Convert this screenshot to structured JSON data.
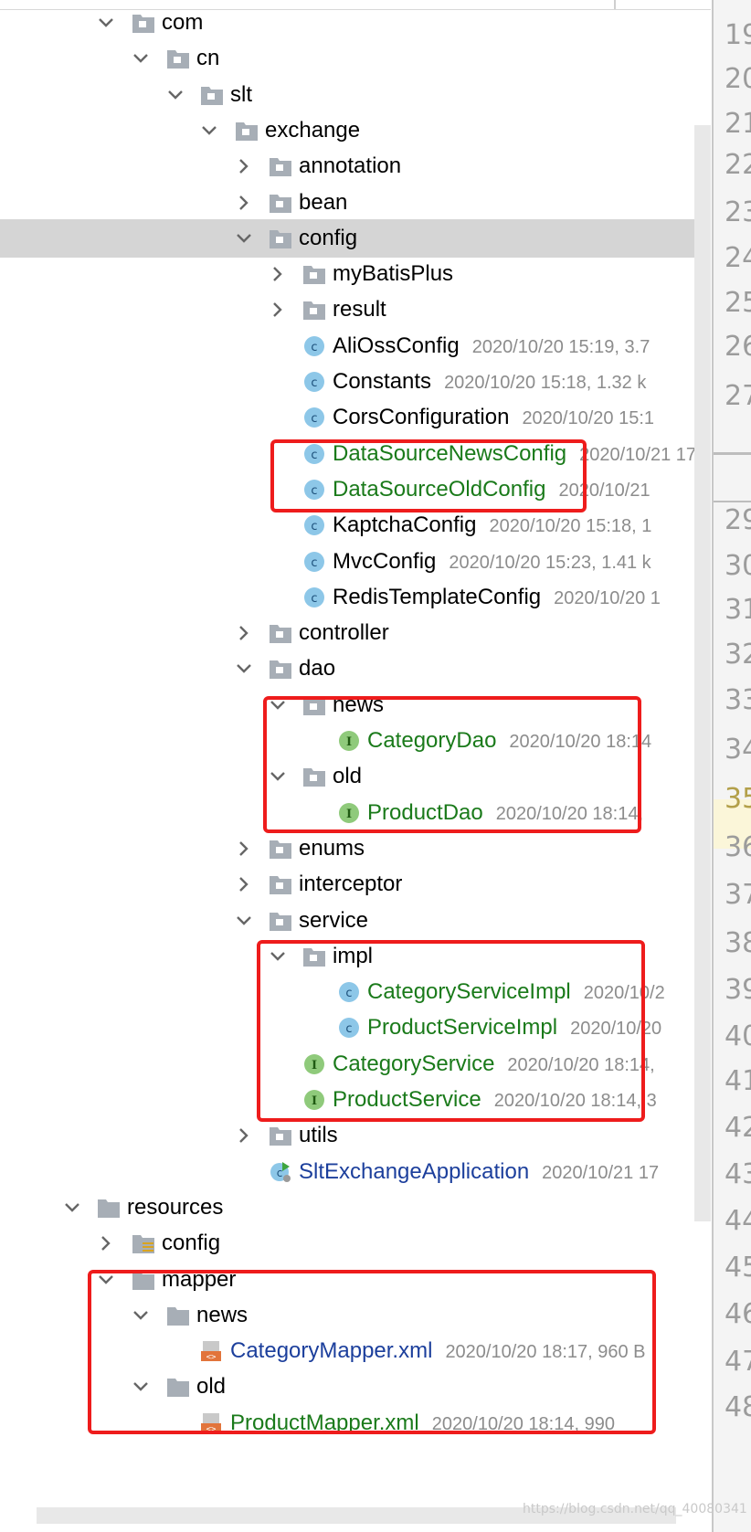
{
  "tree": {
    "rows": [
      {
        "label": "com",
        "kind": "package",
        "expanded": true,
        "meta": "",
        "color": "black"
      },
      {
        "label": "cn",
        "kind": "package",
        "expanded": true,
        "meta": "",
        "color": "black"
      },
      {
        "label": "slt",
        "kind": "package",
        "expanded": true,
        "meta": "",
        "color": "black"
      },
      {
        "label": "exchange",
        "kind": "package",
        "expanded": true,
        "meta": "",
        "color": "black"
      },
      {
        "label": "annotation",
        "kind": "package",
        "expanded": false,
        "meta": "",
        "color": "black"
      },
      {
        "label": "bean",
        "kind": "package",
        "expanded": false,
        "meta": "",
        "color": "black"
      },
      {
        "label": "config",
        "kind": "package",
        "expanded": true,
        "meta": "",
        "color": "black",
        "selected": true
      },
      {
        "label": "myBatisPlus",
        "kind": "package",
        "expanded": false,
        "meta": "",
        "color": "black"
      },
      {
        "label": "result",
        "kind": "package",
        "expanded": false,
        "meta": "",
        "color": "black"
      },
      {
        "label": "AliOssConfig",
        "kind": "class",
        "meta": "2020/10/20 15:19, 3.7",
        "color": "black"
      },
      {
        "label": "Constants",
        "kind": "class",
        "meta": "2020/10/20 15:18, 1.32 k",
        "color": "black"
      },
      {
        "label": "CorsConfiguration",
        "kind": "class",
        "meta": "2020/10/20 15:1",
        "color": "black"
      },
      {
        "label": "DataSourceNewsConfig",
        "kind": "class",
        "meta": "2020/10/21 17",
        "color": "green"
      },
      {
        "label": "DataSourceOldConfig",
        "kind": "class",
        "meta": "2020/10/21",
        "color": "green"
      },
      {
        "label": "KaptchaConfig",
        "kind": "class",
        "meta": "2020/10/20 15:18, 1",
        "color": "black"
      },
      {
        "label": "MvcConfig",
        "kind": "class",
        "meta": "2020/10/20 15:23, 1.41 k",
        "color": "black"
      },
      {
        "label": "RedisTemplateConfig",
        "kind": "class",
        "meta": "2020/10/20 1",
        "color": "black"
      },
      {
        "label": "controller",
        "kind": "package",
        "expanded": false,
        "meta": "",
        "color": "black"
      },
      {
        "label": "dao",
        "kind": "package",
        "expanded": true,
        "meta": "",
        "color": "black"
      },
      {
        "label": "news",
        "kind": "package",
        "expanded": true,
        "meta": "",
        "color": "black"
      },
      {
        "label": "CategoryDao",
        "kind": "interface",
        "meta": "2020/10/20 18:14",
        "color": "green"
      },
      {
        "label": "old",
        "kind": "package",
        "expanded": true,
        "meta": "",
        "color": "black"
      },
      {
        "label": "ProductDao",
        "kind": "interface",
        "meta": "2020/10/20 18:14,",
        "color": "green"
      },
      {
        "label": "enums",
        "kind": "package",
        "expanded": false,
        "meta": "",
        "color": "black"
      },
      {
        "label": "interceptor",
        "kind": "package",
        "expanded": false,
        "meta": "",
        "color": "black"
      },
      {
        "label": "service",
        "kind": "package",
        "expanded": true,
        "meta": "",
        "color": "black"
      },
      {
        "label": "impl",
        "kind": "package",
        "expanded": true,
        "meta": "",
        "color": "black"
      },
      {
        "label": "CategoryServiceImpl",
        "kind": "class",
        "meta": "2020/10/2",
        "color": "green"
      },
      {
        "label": "ProductServiceImpl",
        "kind": "class",
        "meta": "2020/10/20",
        "color": "green"
      },
      {
        "label": "CategoryService",
        "kind": "interface",
        "meta": "2020/10/20 18:14,",
        "color": "green"
      },
      {
        "label": "ProductService",
        "kind": "interface",
        "meta": "2020/10/20 18:14, 3",
        "color": "green"
      },
      {
        "label": "utils",
        "kind": "package",
        "expanded": false,
        "meta": "",
        "color": "black"
      },
      {
        "label": "SltExchangeApplication",
        "kind": "app",
        "meta": "2020/10/21 17",
        "color": "blue"
      },
      {
        "label": "resources",
        "kind": "folder",
        "expanded": true,
        "meta": "",
        "color": "black"
      },
      {
        "label": "config",
        "kind": "resfolder",
        "expanded": false,
        "meta": "",
        "color": "black"
      },
      {
        "label": "mapper",
        "kind": "folder",
        "expanded": true,
        "meta": "",
        "color": "black"
      },
      {
        "label": "news",
        "kind": "folder",
        "expanded": true,
        "meta": "",
        "color": "black"
      },
      {
        "label": "CategoryMapper.xml",
        "kind": "xml",
        "meta": "2020/10/20 18:17, 960 B",
        "color": "blue"
      },
      {
        "label": "old",
        "kind": "folder",
        "expanded": true,
        "meta": "",
        "color": "black"
      },
      {
        "label": "ProductMapper.xml",
        "kind": "xml",
        "meta": "2020/10/20 18:14, 990",
        "color": "green"
      }
    ]
  },
  "gutter": {
    "lines": [
      "19",
      "20",
      "21",
      "22",
      "23",
      "24",
      "25",
      "26",
      "27",
      "29",
      "30",
      "31",
      "32",
      "33",
      "34",
      "35",
      "36",
      "37",
      "38",
      "39",
      "40",
      "41",
      "42",
      "43",
      "44",
      "45",
      "46",
      "47",
      "48"
    ],
    "highlighted": "35"
  },
  "watermark": "https://blog.csdn.net/qq_40080341",
  "colors": {
    "green": "#1a7a1a",
    "blue": "#1c3f9c",
    "selection": "#d5d5d5",
    "highlight_box": "#ee1c1c"
  }
}
